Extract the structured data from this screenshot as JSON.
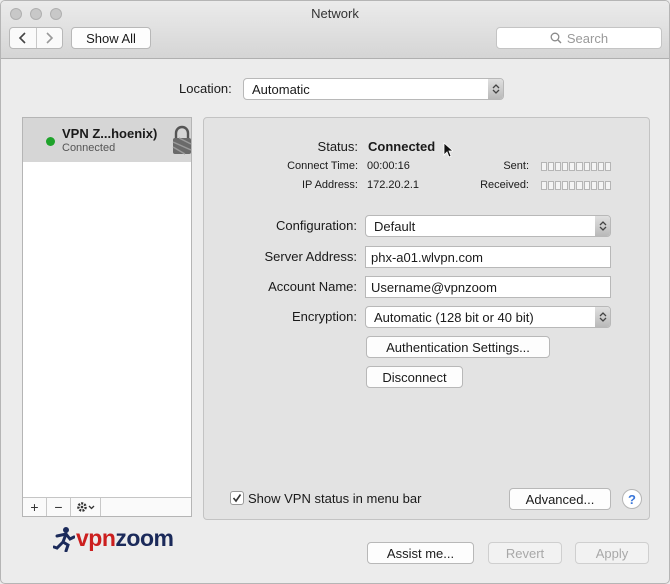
{
  "window": {
    "title": "Network"
  },
  "toolbar": {
    "back_icon": "chevron-left-icon",
    "forward_icon": "chevron-right-icon",
    "show_all_label": "Show All",
    "search_placeholder": "Search"
  },
  "location": {
    "label": "Location:",
    "value": "Automatic"
  },
  "sidebar": {
    "items": [
      {
        "name": "VPN Z...hoenix)",
        "status": "Connected",
        "status_color": "#1fa32b"
      }
    ],
    "footer": {
      "add": "+",
      "remove": "−"
    }
  },
  "status": {
    "label": "Status:",
    "value": "Connected",
    "connect_time_label": "Connect Time:",
    "connect_time": "00:00:16",
    "ip_label": "IP Address:",
    "ip": "172.20.2.1",
    "sent_label": "Sent:",
    "received_label": "Received:"
  },
  "form": {
    "configuration_label": "Configuration:",
    "configuration_value": "Default",
    "server_label": "Server Address:",
    "server_value": "phx-a01.wlvpn.com",
    "account_label": "Account Name:",
    "account_value": "Username@vpnzoom",
    "encryption_label": "Encryption:",
    "encryption_value": "Automatic (128 bit or 40 bit)",
    "auth_button": "Authentication Settings...",
    "disconnect_button": "Disconnect"
  },
  "panel_footer": {
    "show_status_label": "Show VPN status in menu bar",
    "show_status_checked": true,
    "advanced_button": "Advanced...",
    "help": "?"
  },
  "logo": {
    "part1": "vpn",
    "part2": "zoom",
    "color1": "#cc1f1f",
    "color2": "#1b2a5a"
  },
  "bottom": {
    "assist_button": "Assist me...",
    "revert_button": "Revert",
    "apply_button": "Apply"
  },
  "colors": {
    "accent": "#4f86d9",
    "selection": "#d6d6d6"
  }
}
